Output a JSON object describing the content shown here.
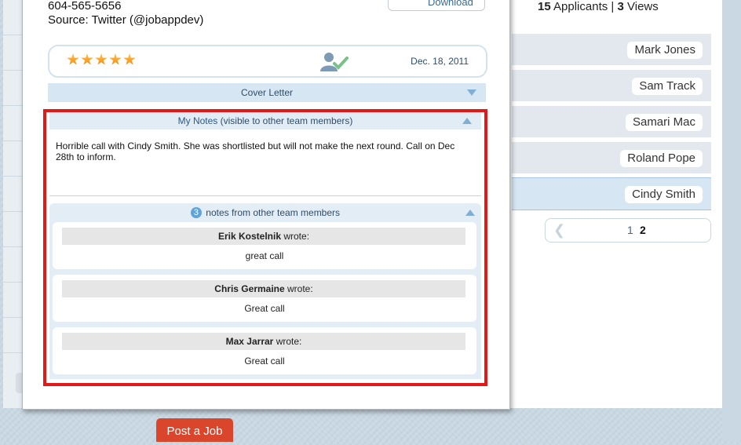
{
  "contact": {
    "phone": "604-565-5656",
    "source": "Source: Twitter (@jobappdev)",
    "download_label": "Download"
  },
  "rating": {
    "stars": 5,
    "date": "Dec. 18, 2011",
    "shortlist_icon": "person-check-icon"
  },
  "cover_letter": {
    "label": "Cover Letter"
  },
  "my_notes": {
    "title": "My Notes",
    "subtitle": "(visible to other team members)",
    "text": "Horrible call with Cindy Smith. She was shortlisted but will not make the next round. Call on Dec 28th to inform."
  },
  "team_notes": {
    "count": "3",
    "label": "notes from other team members",
    "notes": [
      {
        "author": "Erik Kostelnik",
        "wrote": "wrote:",
        "text": "great call"
      },
      {
        "author": "Chris Germaine",
        "wrote": "wrote:",
        "text": "Great call"
      },
      {
        "author": "Max Jarrar",
        "wrote": "wrote:",
        "text": "Great call"
      }
    ]
  },
  "stats": {
    "applicants_count": "15",
    "applicants_label": "Applicants",
    "separator": "|",
    "views_count": "3",
    "views_label": "Views"
  },
  "applicants": [
    {
      "name": "Mark Jones"
    },
    {
      "name": "Sam Track"
    },
    {
      "name": "Samari Mac"
    },
    {
      "name": "Roland Pope"
    },
    {
      "name": "Cindy Smith",
      "active": true
    }
  ],
  "pagination": {
    "prev_icon": "chevron-left-icon",
    "page1": "1",
    "page2": "2",
    "current": "2"
  },
  "post_job": {
    "label": "Post a Job"
  },
  "colors": {
    "highlight": "#e31818",
    "post_button": "#d9462c",
    "accent_blue": "#7fb0d3"
  }
}
